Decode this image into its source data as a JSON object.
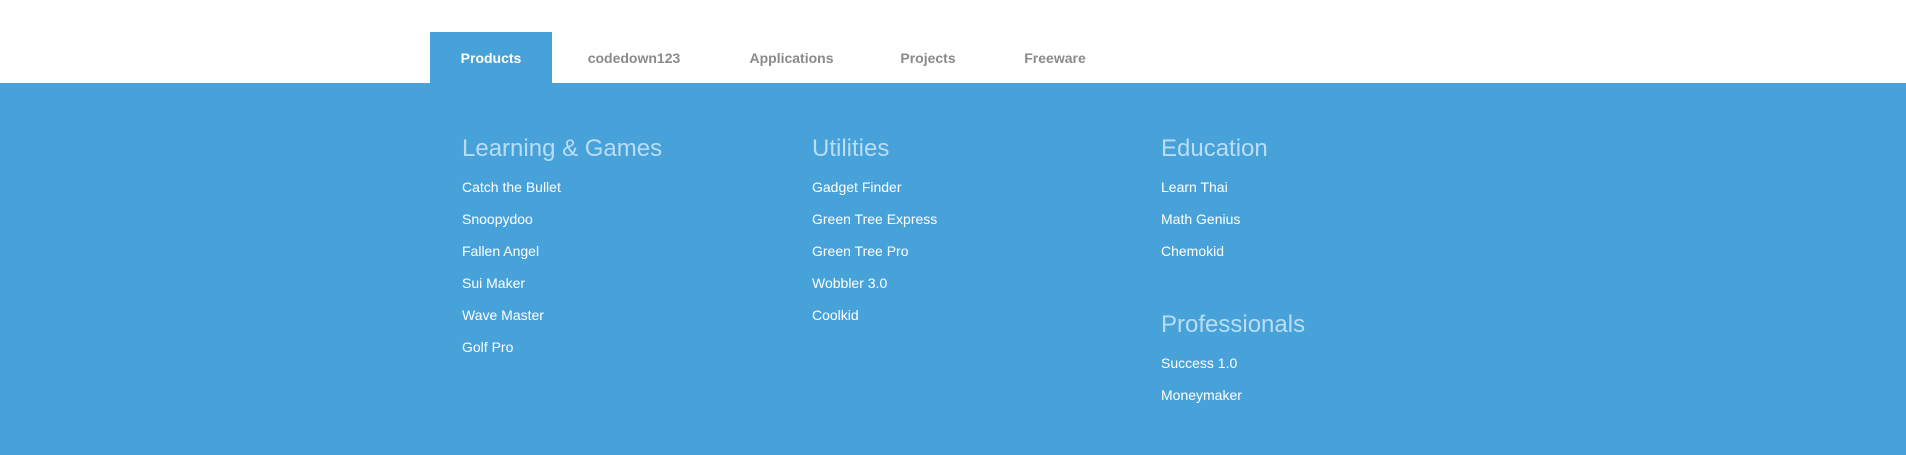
{
  "nav": {
    "tabs": [
      {
        "label": "Products",
        "active": true
      },
      {
        "label": "codedown123",
        "active": false
      },
      {
        "label": "Applications",
        "active": false
      },
      {
        "label": "Projects",
        "active": false
      },
      {
        "label": "Freeware",
        "active": false
      }
    ]
  },
  "menu": {
    "learning_games": {
      "heading": "Learning & Games",
      "items": [
        "Catch the Bullet",
        "Snoopydoo",
        "Fallen Angel",
        "Sui Maker",
        "Wave Master",
        "Golf Pro"
      ]
    },
    "utilities": {
      "heading": "Utilities",
      "items": [
        "Gadget Finder",
        "Green Tree Express",
        "Green Tree Pro",
        "Wobbler 3.0",
        "Coolkid"
      ]
    },
    "education": {
      "heading": "Education",
      "items": [
        "Learn Thai",
        "Math Genius",
        "Chemokid"
      ]
    },
    "professionals": {
      "heading": "Professionals",
      "items": [
        "Success 1.0",
        "Moneymaker"
      ]
    }
  },
  "colors": {
    "accent": "#48a2da",
    "heading": "#b9ddf4",
    "nav_text": "#8a8a8a"
  }
}
